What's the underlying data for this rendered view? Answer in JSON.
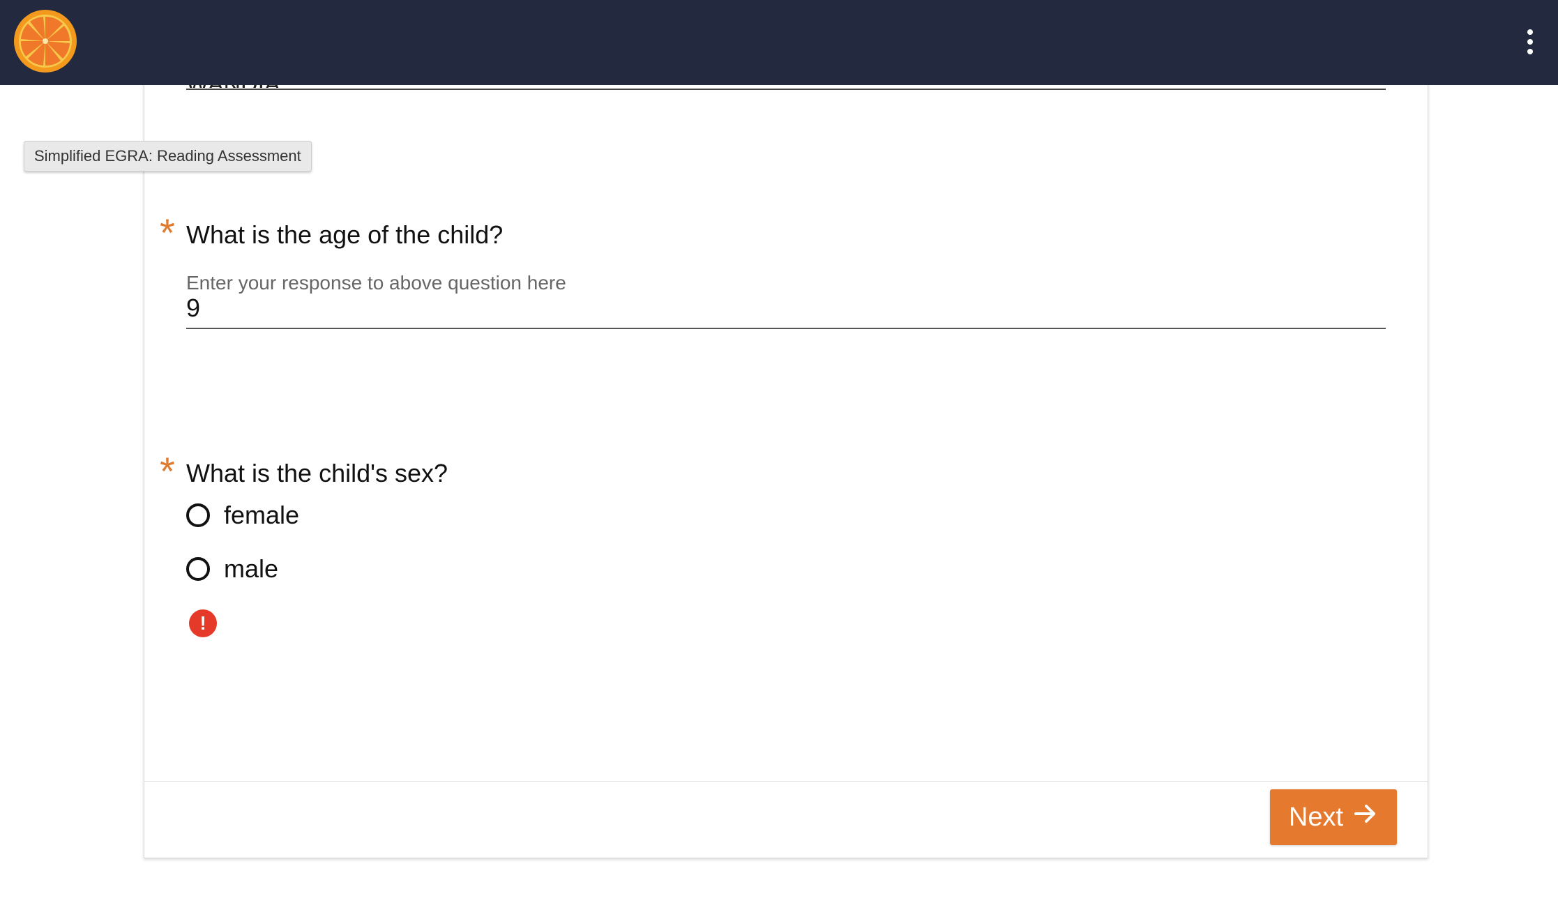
{
  "app": {
    "logo_icon": "orange-slice-logo",
    "menu_icon": "more-vertical-icon",
    "tooltip": "Simplified EGRA: Reading Assessment"
  },
  "form": {
    "prev_field_value": "WANDIA",
    "age_question": {
      "label": "What is the age of the child?",
      "required_marker": "*",
      "input_label": "Enter your response to above question here",
      "value": "9"
    },
    "sex_question": {
      "label": "What is the child's sex?",
      "required_marker": "*",
      "options": [
        "female",
        "male"
      ],
      "error_icon": "alert-circle-icon",
      "error_glyph": "!"
    }
  },
  "footer": {
    "next_label": "Next",
    "next_icon": "arrow-right-icon"
  },
  "colors": {
    "topbar": "#232a3f",
    "accent": "#e57a2e",
    "error": "#e53a2a"
  }
}
